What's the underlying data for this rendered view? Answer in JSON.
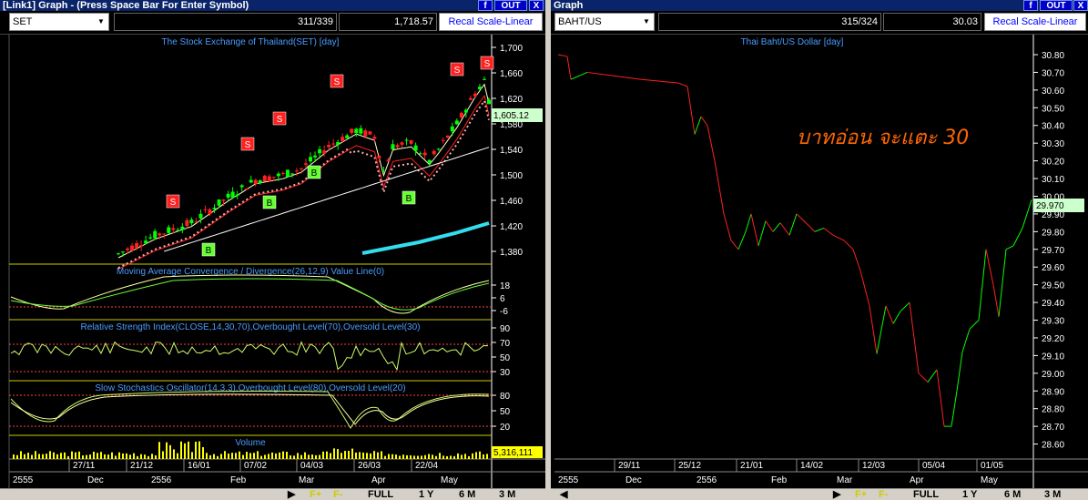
{
  "left": {
    "title": "[Link1] Graph  - (Press Space Bar For Enter Symbol)",
    "buttons": {
      "f": "f",
      "out": "OUT",
      "x": "X"
    },
    "symbol": "SET",
    "bars": "311/339",
    "last": "1,718.57",
    "recal": "Recal Scale-Linear",
    "main_title": "The Stock Exchange of Thailand(SET) [day]",
    "price_ticks": [
      "1,700",
      "1,660",
      "1,620",
      "1,580",
      "1,540",
      "1,500",
      "1,460",
      "1,420",
      "1,380"
    ],
    "price_label": "1,605.12",
    "macd_title": "Moving Average Convergence / Divergence(26,12,9) Value Line(0)",
    "macd_ticks": [
      "18",
      "6",
      "-6"
    ],
    "rsi_title": "Relative Strength Index(CLOSE,14,30,70),Overbought Level(70),Oversold Level(30)",
    "rsi_ticks": [
      "90",
      "70",
      "50",
      "30"
    ],
    "sto_title": "Slow Stochastics Oscillator(14,3,3),Overbought Level(80),Oversold Level(20)",
    "sto_ticks": [
      "80",
      "50",
      "20"
    ],
    "vol_title": "Volume",
    "vol_label": "5,316,111",
    "signals": [
      "S",
      "S",
      "S",
      "S",
      "S",
      "S",
      "B",
      "B",
      "B",
      "B"
    ],
    "date_ticks": [
      "27/11",
      "21/12",
      "16/01",
      "07/02",
      "04/03",
      "26/03",
      "22/04"
    ],
    "month_ticks": [
      "2555",
      "Dec",
      "2556",
      "Feb",
      "Mar",
      "Apr",
      "May"
    ],
    "footer": [
      "F+",
      "F-",
      "FULL",
      "1 Y",
      "6 M",
      "3 M"
    ]
  },
  "right": {
    "title": "Graph",
    "buttons": {
      "f": "f",
      "out": "OUT",
      "x": "X"
    },
    "symbol": "BAHT/US",
    "bars": "315/324",
    "last": "30.03",
    "recal": "Recal Scale-Linear",
    "main_title": "Thai Baht/US Dollar [day]",
    "annotation": "บาทอ่อน จะแตะ 30",
    "price_ticks": [
      "30.80",
      "30.70",
      "30.60",
      "30.50",
      "30.40",
      "30.30",
      "30.20",
      "30.10",
      "30.00",
      "29.90",
      "29.80",
      "29.70",
      "29.60",
      "29.50",
      "29.40",
      "29.30",
      "29.20",
      "29.10",
      "29.00",
      "28.90",
      "28.80",
      "28.70",
      "28.60"
    ],
    "price_label": "29.970",
    "date_ticks": [
      "29/11",
      "25/12",
      "21/01",
      "14/02",
      "12/03",
      "05/04",
      "01/05"
    ],
    "month_ticks": [
      "2555",
      "Dec",
      "2556",
      "Feb",
      "Mar",
      "Apr",
      "May"
    ],
    "footer": [
      "F+",
      "F-",
      "FULL",
      "1 Y",
      "6 M",
      "3 M"
    ]
  },
  "colors": {
    "up": "#00ff00",
    "down": "#ff2020",
    "axis_text": "#ffffff",
    "panel_title": "#4a9cff",
    "grid": "#ffff00"
  }
}
